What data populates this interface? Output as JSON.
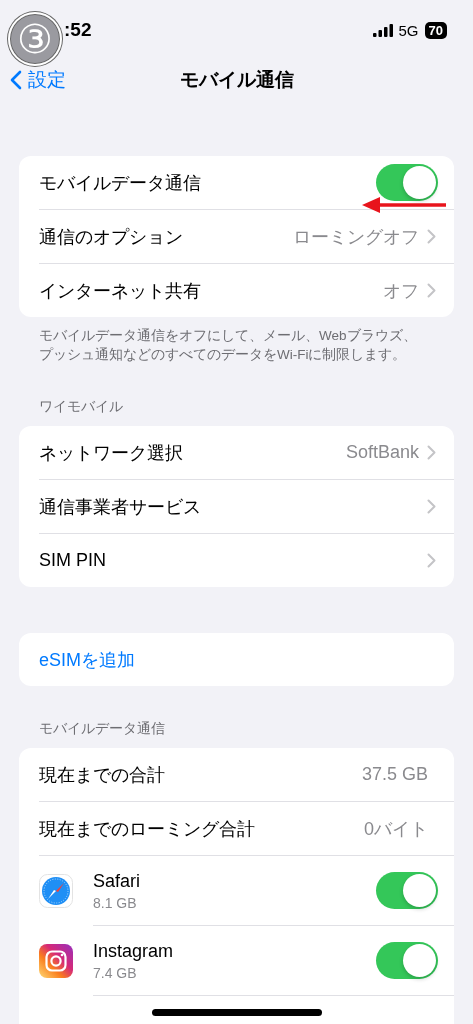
{
  "status_bar": {
    "time": ":52",
    "network": "5G",
    "battery": "70"
  },
  "step_badge": "③",
  "nav": {
    "back": "設定",
    "title": "モバイル通信"
  },
  "sections": [
    {
      "rows": [
        {
          "kind": "toggle",
          "label": "モバイルデータ通信",
          "on": true
        },
        {
          "kind": "detail",
          "label": "通信のオプション",
          "value": "ローミングオフ"
        },
        {
          "kind": "detail",
          "label": "インターネット共有",
          "value": "オフ"
        }
      ],
      "footer": "モバイルデータ通信をオフにして、メール、Webブラウズ、プッシュ通知などのすべてのデータをWi-Fiに制限します。"
    },
    {
      "header": "ワイモバイル",
      "rows": [
        {
          "kind": "detail",
          "label": "ネットワーク選択",
          "value": "SoftBank"
        },
        {
          "kind": "detail",
          "label": "通信事業者サービス"
        },
        {
          "kind": "detail",
          "label": "SIM PIN"
        }
      ]
    },
    {
      "rows": [
        {
          "kind": "link",
          "label": "eSIMを追加"
        }
      ]
    },
    {
      "header": "モバイルデータ通信",
      "rows": [
        {
          "kind": "value",
          "label": "現在までの合計",
          "value": "37.5 GB"
        },
        {
          "kind": "value",
          "label": "現在までのローミング合計",
          "value": "0バイト"
        },
        {
          "kind": "app",
          "label": "Safari",
          "value": "8.1 GB",
          "on": true
        },
        {
          "kind": "app",
          "label": "Instagram",
          "value": "7.4 GB",
          "on": true
        }
      ]
    }
  ]
}
